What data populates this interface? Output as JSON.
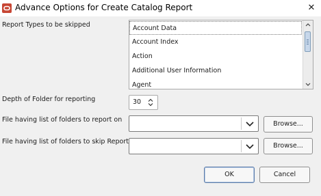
{
  "window": {
    "title": "Advance Options for Create Catalog Report",
    "close_glyph": "✕",
    "app_icon": "oracle-logo"
  },
  "report_types": {
    "label": "Report Types to be skipped",
    "items": [
      "Account Data",
      "Account Index",
      "Action",
      "Additional User Information",
      "Agent"
    ],
    "selected_index": 0
  },
  "depth": {
    "label": "Depth of Folder for reporting",
    "value": "30"
  },
  "folders_report": {
    "label": "File having list of folders to report on",
    "value": "",
    "browse_label": "Browse..."
  },
  "folders_skip": {
    "label": "File having list of folders to skip Report",
    "value": "",
    "browse_label": "Browse..."
  },
  "buttons": {
    "ok": "OK",
    "cancel": "Cancel"
  },
  "colors": {
    "background": "#f0f0f0",
    "oracle_red": "#c74634",
    "selection_border": "#777777",
    "scroll_thumb": "#c7d7ea"
  }
}
